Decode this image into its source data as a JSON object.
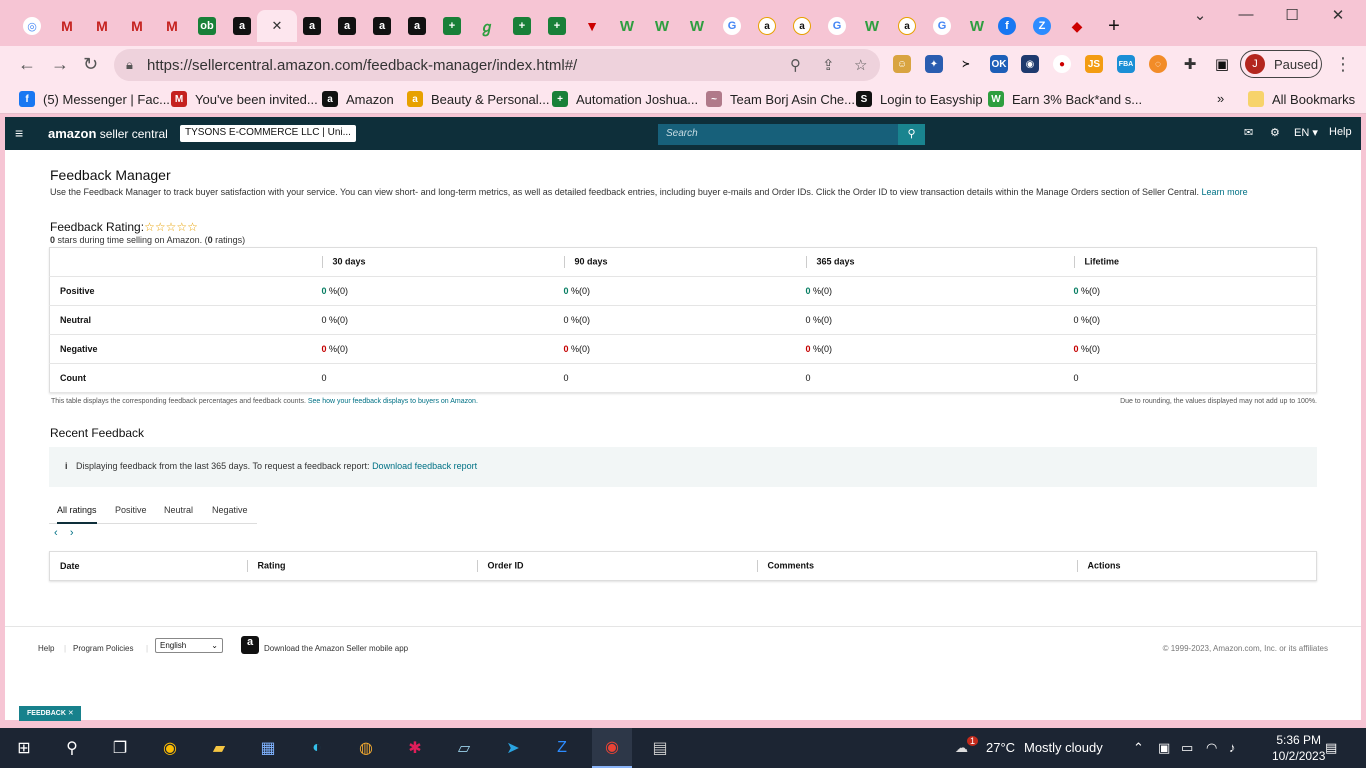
{
  "browser": {
    "tabs": [
      {
        "icon": "chrome-icon",
        "glyph": "◎",
        "cls": "goog"
      },
      {
        "icon": "gmail-icon",
        "glyph": "M",
        "cls": "gm"
      },
      {
        "icon": "gmail-icon",
        "glyph": "M",
        "cls": "gm"
      },
      {
        "icon": "gmail-icon",
        "glyph": "M",
        "cls": "gm"
      },
      {
        "icon": "gmail-icon",
        "glyph": "M",
        "cls": "gm"
      },
      {
        "icon": "green-circle-icon",
        "glyph": "ob",
        "cls": "sheet"
      },
      {
        "icon": "amazon-icon",
        "glyph": "a",
        "cls": "amz"
      },
      {
        "icon": "close-icon",
        "glyph": "✕",
        "cls": "",
        "active": true
      },
      {
        "icon": "amazon-icon",
        "glyph": "a",
        "cls": "amz"
      },
      {
        "icon": "amazon-icon",
        "glyph": "a",
        "cls": "amz"
      },
      {
        "icon": "amazon-icon",
        "glyph": "a",
        "cls": "amz"
      },
      {
        "icon": "amazon-icon",
        "glyph": "a",
        "cls": "amz"
      },
      {
        "icon": "sheets-icon",
        "glyph": "+",
        "cls": "sheet"
      },
      {
        "icon": "tool-icon",
        "glyph": "ℊ",
        "cls": "green"
      },
      {
        "icon": "sheets-icon",
        "glyph": "+",
        "cls": "sheet"
      },
      {
        "icon": "sheets-icon",
        "glyph": "+",
        "cls": "sheet"
      },
      {
        "icon": "down-arrow-icon",
        "glyph": "▼",
        "cls": "red"
      },
      {
        "icon": "w-logo-icon",
        "glyph": "W",
        "cls": "green"
      },
      {
        "icon": "w-logo-icon",
        "glyph": "W",
        "cls": "green"
      },
      {
        "icon": "w-logo-icon",
        "glyph": "W",
        "cls": "green"
      },
      {
        "icon": "google-icon",
        "glyph": "G",
        "cls": "goog"
      },
      {
        "icon": "amazon-circle-icon",
        "glyph": "a",
        "cls": "amzc"
      },
      {
        "icon": "amazon-circle-icon",
        "glyph": "a",
        "cls": "amzc"
      },
      {
        "icon": "google-icon",
        "glyph": "G",
        "cls": "goog"
      },
      {
        "icon": "w-logo-icon",
        "glyph": "W",
        "cls": "green"
      },
      {
        "icon": "amazon-circle-icon",
        "glyph": "a",
        "cls": "amzc"
      },
      {
        "icon": "google-icon",
        "glyph": "G",
        "cls": "goog"
      },
      {
        "icon": "w-logo-icon",
        "glyph": "W",
        "cls": "green"
      },
      {
        "icon": "facebook-icon",
        "glyph": "f",
        "cls": "fb"
      },
      {
        "icon": "zoom-icon",
        "glyph": "Z",
        "cls": "z"
      },
      {
        "icon": "bookmark-app-icon",
        "glyph": "◆",
        "cls": "red"
      }
    ],
    "new_tab": "+",
    "url": "https://sellercentral.amazon.com/feedback-manager/index.html#/",
    "profile_initial": "J",
    "profile_status": "Paused",
    "bookmarks": [
      {
        "label": "(5) Messenger | Fac...",
        "glyph": "f",
        "color": "#1877f2"
      },
      {
        "label": "You've been invited...",
        "glyph": "M",
        "color": "#c5221f"
      },
      {
        "label": "Amazon",
        "glyph": "a",
        "color": "#111111"
      },
      {
        "label": "Beauty & Personal...",
        "glyph": "a",
        "color": "#e7a100"
      },
      {
        "label": "Automation Joshua...",
        "glyph": "+",
        "color": "#188038"
      },
      {
        "label": "Team Borj Asin Che...",
        "glyph": "~",
        "color": "#b07a8a"
      },
      {
        "label": "Login to Easyship",
        "glyph": "S",
        "color": "#111111"
      },
      {
        "label": "Earn 3% Back*and s...",
        "glyph": "W",
        "color": "#2e9e3f"
      }
    ],
    "all_bookmarks": "All Bookmarks"
  },
  "header": {
    "logo_brand": "amazon",
    "logo_sub": "seller central",
    "account": "TYSONS E-COMMERCE LLC | Uni...",
    "search_placeholder": "Search",
    "lang": "EN ▾",
    "help": "Help"
  },
  "page": {
    "title": "Feedback Manager",
    "description": "Use the Feedback Manager to track buyer satisfaction with your service. You can view short- and long-term metrics, as well as detailed feedback entries, including buyer e-mails and Order IDs. Click the Order ID to view transaction details within the Manage Orders section of Seller Central.",
    "learn_more": "Learn more",
    "rating_label": "Feedback Rating:",
    "stars": "☆☆☆☆☆",
    "rating_count": "0",
    "rating_sub_mid": " stars during time selling on Amazon. (",
    "rating_num": "0",
    "rating_sub_end": " ratings)",
    "table": {
      "headers": [
        "",
        "30 days",
        "90 days",
        "365 days",
        "Lifetime"
      ],
      "rows": [
        {
          "label": "Positive",
          "kind": "g",
          "cells": [
            [
              "0",
              " %(0)"
            ],
            [
              "0",
              " %(0)"
            ],
            [
              "0",
              " %(0)"
            ],
            [
              "0",
              " %(0)"
            ]
          ]
        },
        {
          "label": "Neutral",
          "kind": "",
          "cells": [
            [
              "0",
              " %(0)"
            ],
            [
              "0",
              " %(0)"
            ],
            [
              "0",
              " %(0)"
            ],
            [
              "0",
              " %(0)"
            ]
          ]
        },
        {
          "label": "Negative",
          "kind": "r",
          "cells": [
            [
              "0",
              " %(0)"
            ],
            [
              "0",
              " %(0)"
            ],
            [
              "0",
              " %(0)"
            ],
            [
              "0",
              " %(0)"
            ]
          ]
        },
        {
          "label": "Count",
          "kind": "count",
          "cells": [
            [
              "0",
              ""
            ],
            [
              "0",
              ""
            ],
            [
              "0",
              ""
            ],
            [
              "0",
              ""
            ]
          ]
        }
      ]
    },
    "table_note": "This table displays the corresponding feedback percentages and feedback counts.",
    "table_note_link": "See how your feedback displays to buyers on Amazon.",
    "rounding_note": "Due to rounding, the values displayed may not add up to 100%.",
    "recent_title": "Recent Feedback",
    "info_icon": "i",
    "info_text": "Displaying feedback from the last 365 days. To request a feedback report:",
    "info_link": "Download feedback report",
    "filter_tabs": [
      "All ratings",
      "Positive",
      "Neutral",
      "Negative"
    ],
    "prev": "‹",
    "next": "›",
    "recent_headers": [
      "Date",
      "Rating",
      "Order ID",
      "Comments",
      "Actions"
    ]
  },
  "footer": {
    "help": "Help",
    "policies": "Program Policies",
    "language": "English",
    "app_text": "Download the Amazon Seller mobile app",
    "copyright": "© 1999-2023, Amazon.com, Inc. or its affiliates",
    "feedback_btn": "FEEDBACK ✕"
  },
  "taskbar": {
    "weather_temp": "27°C",
    "weather_text": "Mostly cloudy",
    "weather_badge": "1",
    "time": "5:36 PM",
    "date": "10/2/2023"
  }
}
